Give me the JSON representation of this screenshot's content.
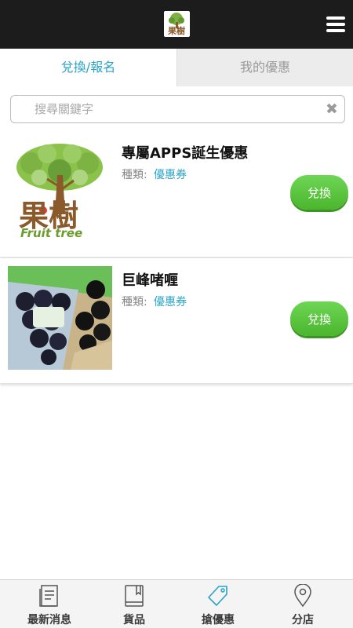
{
  "header": {
    "logo_icon": "fruit-tree-logo",
    "menu_icon": "hamburger-menu-icon",
    "background": "#1c1c1c"
  },
  "tabs": [
    {
      "label": "兌換/報名",
      "active": true
    },
    {
      "label": "我的優惠",
      "active": false
    }
  ],
  "search": {
    "placeholder": "搜尋關鍵字",
    "value": "",
    "clear_icon": "close-icon"
  },
  "coupons": [
    {
      "title": "專屬APPS誕生優惠",
      "type_label": "種類:",
      "type_value": "優惠券",
      "image": "fruit-tree-brand-logo",
      "button_label": "兌換"
    },
    {
      "title": "巨峰啫喱",
      "type_label": "種類:",
      "type_value": "優惠券",
      "image": "grape-jelly-product-photo",
      "button_label": "兌換"
    }
  ],
  "logo_text": {
    "brand_cn": "果樹",
    "brand_en": "Fruit tree"
  },
  "bottom_nav": [
    {
      "label": "最新消息",
      "icon": "news-icon"
    },
    {
      "label": "貨品",
      "icon": "book-icon"
    },
    {
      "label": "搶優惠",
      "icon": "tag-icon"
    },
    {
      "label": "分店",
      "icon": "location-pin-icon"
    }
  ],
  "colors": {
    "accent": "#2aa3c6",
    "button_green": "#5cc640"
  }
}
